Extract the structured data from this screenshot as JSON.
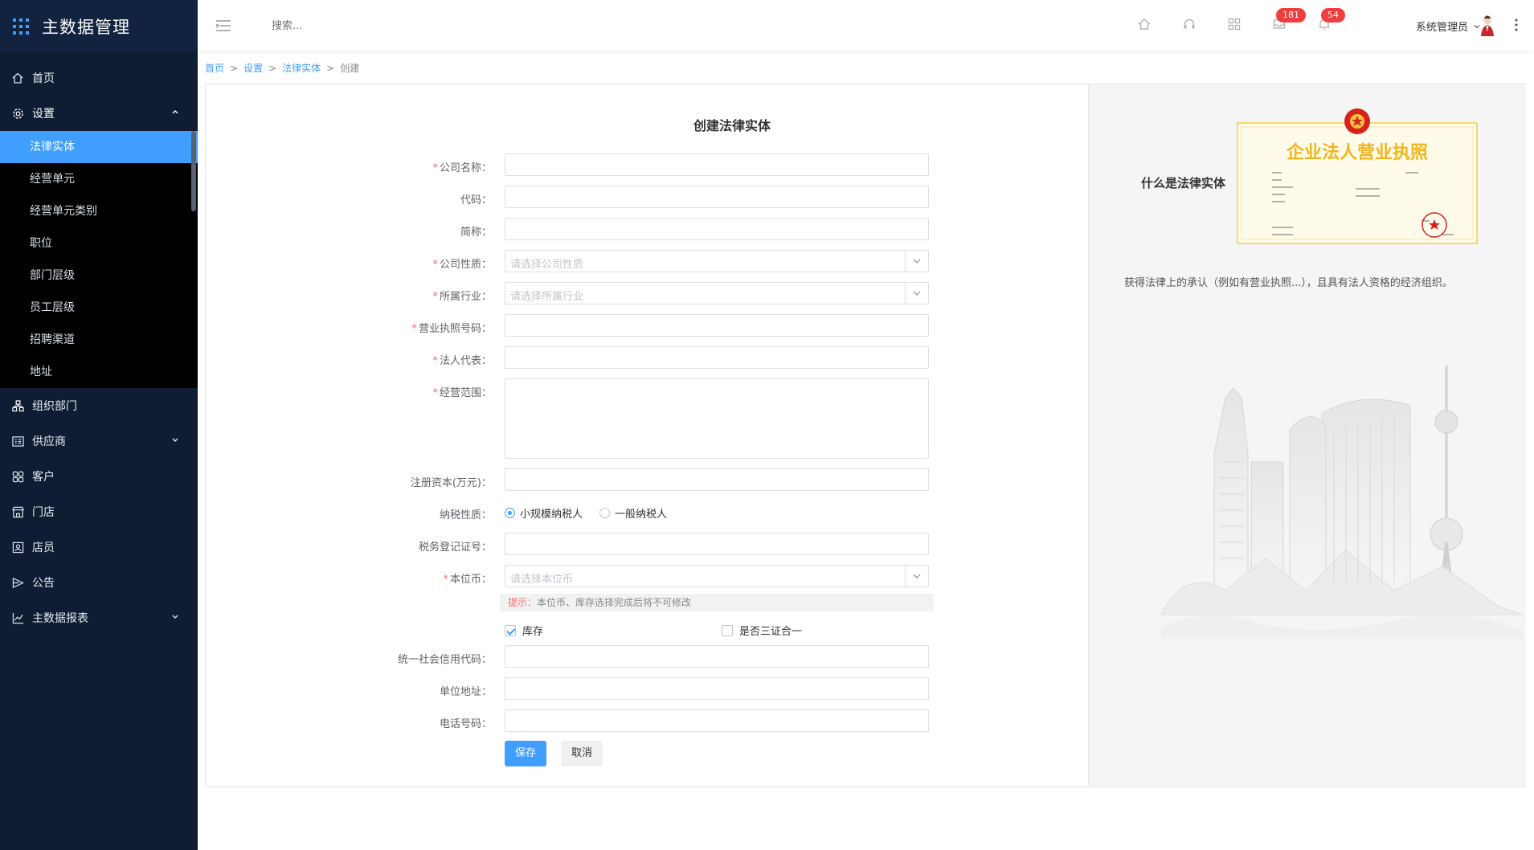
{
  "app": {
    "title": "主数据管理"
  },
  "sidebar": {
    "items": [
      {
        "label": "首页",
        "icon": "home-icon"
      },
      {
        "label": "设置",
        "icon": "gear-icon",
        "open": true
      },
      {
        "label": "组织部门",
        "icon": "org-icon"
      },
      {
        "label": "供应商",
        "icon": "supplier-icon"
      },
      {
        "label": "客户",
        "icon": "customer-icon"
      },
      {
        "label": "门店",
        "icon": "store-icon"
      },
      {
        "label": "店员",
        "icon": "clerk-icon"
      },
      {
        "label": "公告",
        "icon": "notice-icon"
      },
      {
        "label": "主数据报表",
        "icon": "chart-icon"
      }
    ],
    "settings_sub": [
      "法律实体",
      "经营单元",
      "经营单元类别",
      "职位",
      "部门层级",
      "员工层级",
      "招聘渠道",
      "地址"
    ]
  },
  "header": {
    "search_placeholder": "搜索...",
    "badge_mail": "181",
    "badge_bell": "54",
    "user_name": "系统管理员"
  },
  "breadcrumb": {
    "home": "首页",
    "settings": "设置",
    "legal": "法律实体",
    "current": "创建",
    "sep": ">"
  },
  "form": {
    "title": "创建法律实体",
    "company_name": "公司名称：",
    "code": "代码：",
    "short_name": "简称：",
    "company_type": "公司性质：",
    "company_type_ph": "请选择公司性质",
    "industry": "所属行业：",
    "industry_ph": "请选择所属行业",
    "license_no": "营业执照号码：",
    "legal_rep": "法人代表：",
    "scope": "经营范围：",
    "capital": "注册资本(万元)：",
    "tax_type": "纳税性质：",
    "tax_small": "小规模纳税人",
    "tax_general": "一般纳税人",
    "tax_reg": "税务登记证号：",
    "currency": "本位币：",
    "currency_ph": "请选择本位币",
    "tip_key": "提示：",
    "tip_text": "本位币、库存选择完成后将不可修改",
    "chk_inventory": "库存",
    "chk_three": "是否三证合一",
    "credit_code": "统一社会信用代码：",
    "address": "单位地址：",
    "phone": "电话号码：",
    "save": "保存",
    "cancel": "取消"
  },
  "info": {
    "title": "什么是法律实体",
    "desc": "获得法律上的承认（例如有营业执照...），且具有法人资格的经济组织。",
    "license_title": "企业法人营业执照"
  },
  "colors": {
    "accent": "#409eff",
    "sidebar_bg": "#0f1c33",
    "required": "#f56c6c"
  }
}
